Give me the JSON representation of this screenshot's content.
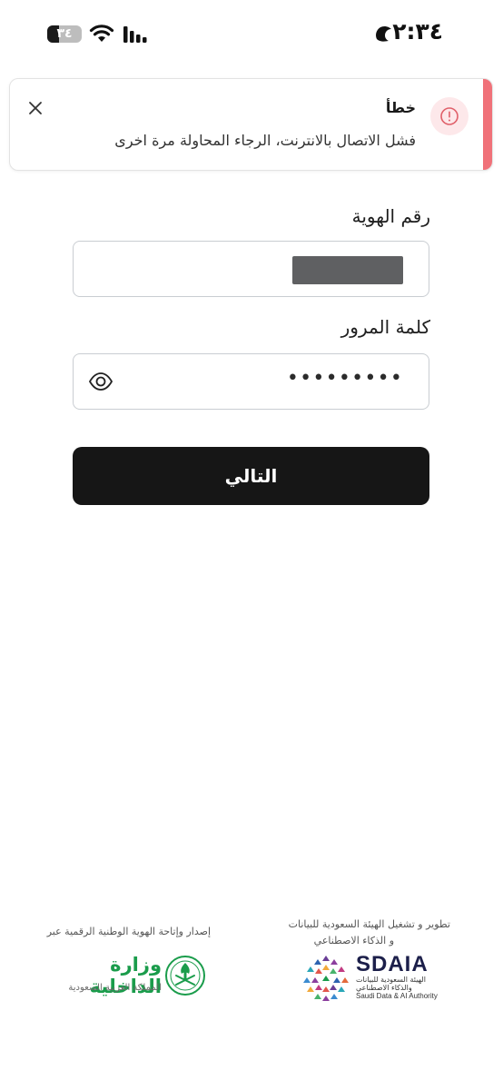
{
  "status_bar": {
    "time": "٢:٣٤",
    "battery_level": "٣٤",
    "battery_percent": 34
  },
  "toast": {
    "title": "خطأ",
    "message": "فشل الاتصال  بالانترنت، الرجاء المحاولة مرة اخرى",
    "accent_color": "#f07179",
    "icon": "alert-circle-icon"
  },
  "form": {
    "id_label": "رقم الهوية",
    "password_label": "كلمة المرور",
    "password_value": "•••••••••",
    "next_label": "التالي",
    "show_password_icon": "eye-icon"
  },
  "footer": {
    "moi": {
      "caption": "إصدار وإتاحة الهوية الوطنية الرقمية عبر",
      "name": "وزارة الداخلية",
      "subtitle": "المملكة العربية السعودية",
      "color": "#1a9c4b"
    },
    "sdaia": {
      "caption_line1": "تطوير و تشغيل الهيئة السعودية للبيانات",
      "caption_line2": "و الذكاء الاصطناعي",
      "name": "SDAIA",
      "name_ar": "الهيئة السعودية للبيانات والذكاء الاصطناعي",
      "name_en": "Saudi Data & AI Authority"
    }
  }
}
